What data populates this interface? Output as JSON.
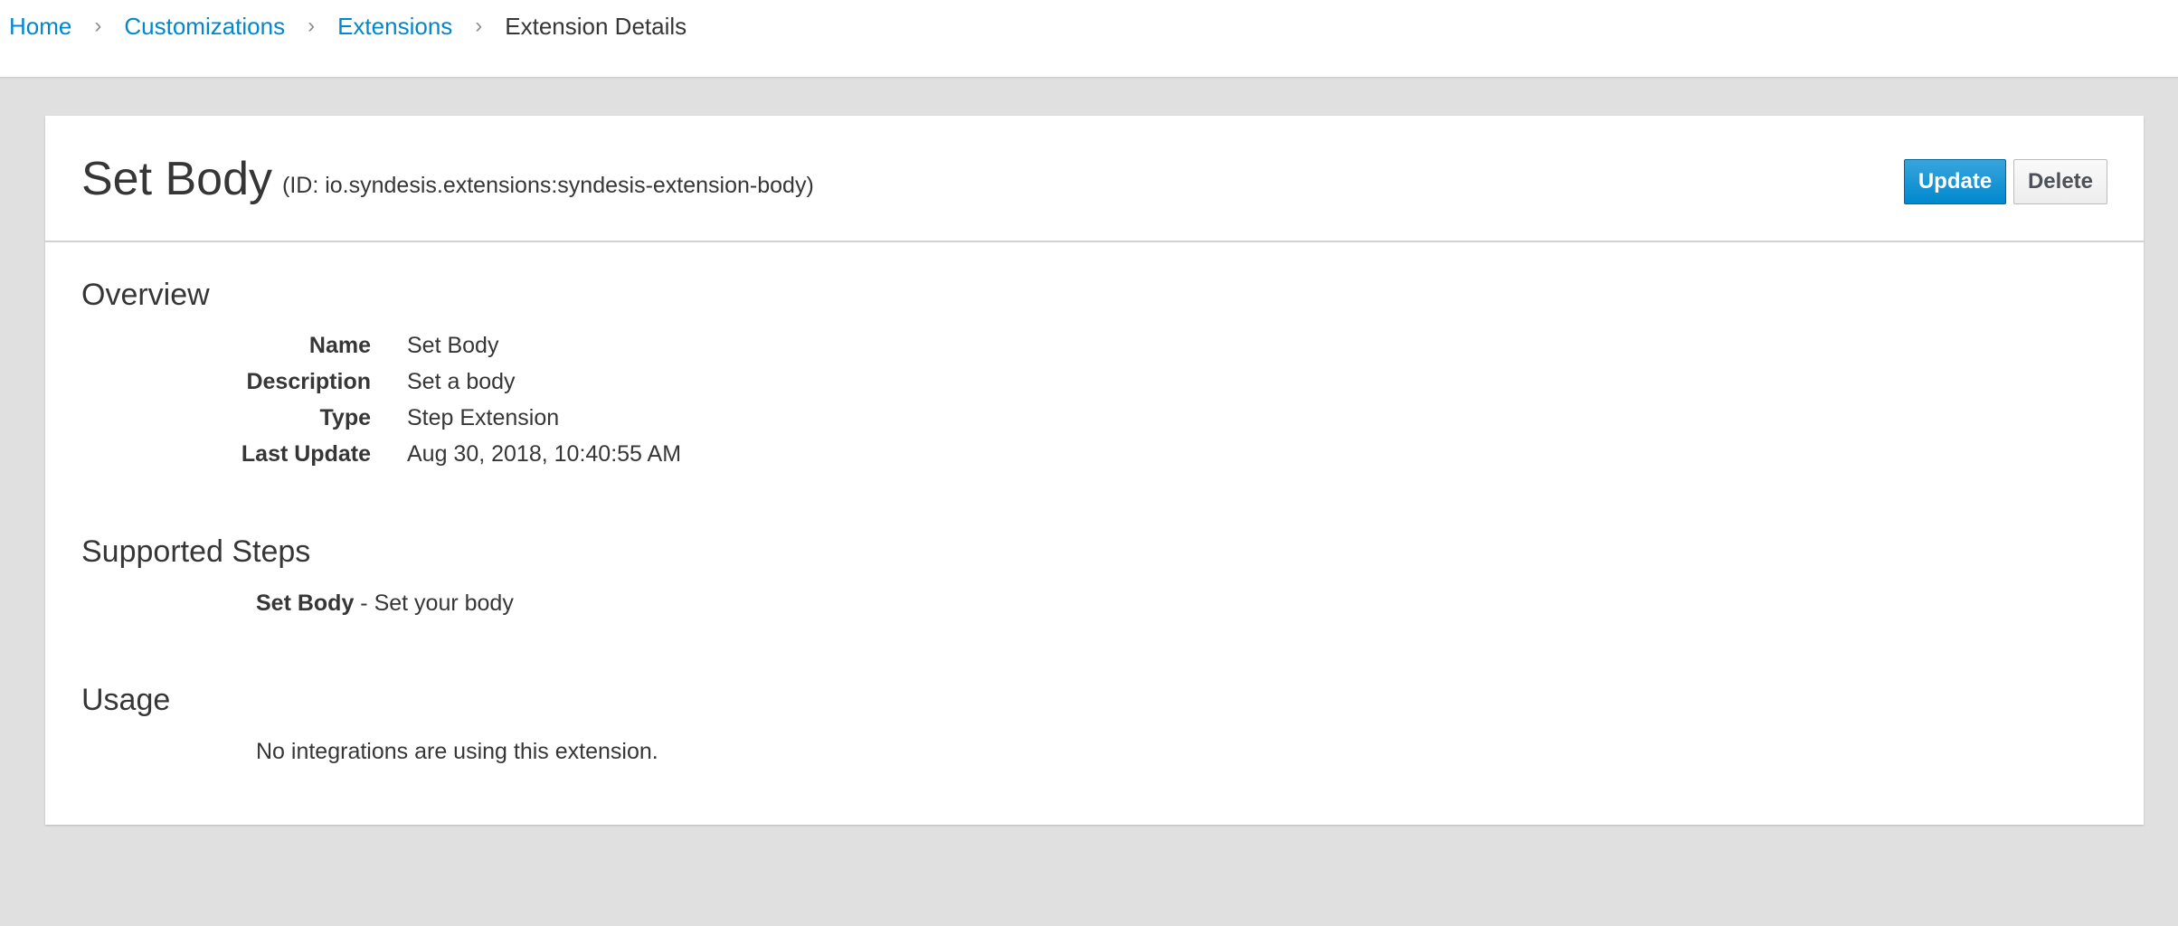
{
  "breadcrumb": {
    "items": [
      "Home",
      "Customizations",
      "Extensions"
    ],
    "current": "Extension Details",
    "separator": "›"
  },
  "extension": {
    "title": "Set Body",
    "id_text": "(ID: io.syndesis.extensions:syndesis-extension-body)"
  },
  "actions": {
    "update_label": "Update",
    "delete_label": "Delete"
  },
  "overview": {
    "title": "Overview",
    "fields": [
      {
        "term": "Name",
        "value": "Set Body"
      },
      {
        "term": "Description",
        "value": "Set a body"
      },
      {
        "term": "Type",
        "value": "Step Extension"
      },
      {
        "term": "Last Update",
        "value": "Aug 30, 2018, 10:40:55 AM"
      }
    ]
  },
  "supported_steps": {
    "title": "Supported Steps",
    "steps": [
      {
        "name": "Set Body",
        "separator": " - ",
        "description": "Set your body"
      }
    ]
  },
  "usage": {
    "title": "Usage",
    "message": "No integrations are using this extension."
  },
  "colors": {
    "link": "#0088ce",
    "primary_button": "#0088ce",
    "page_background": "#e0e0e0"
  }
}
